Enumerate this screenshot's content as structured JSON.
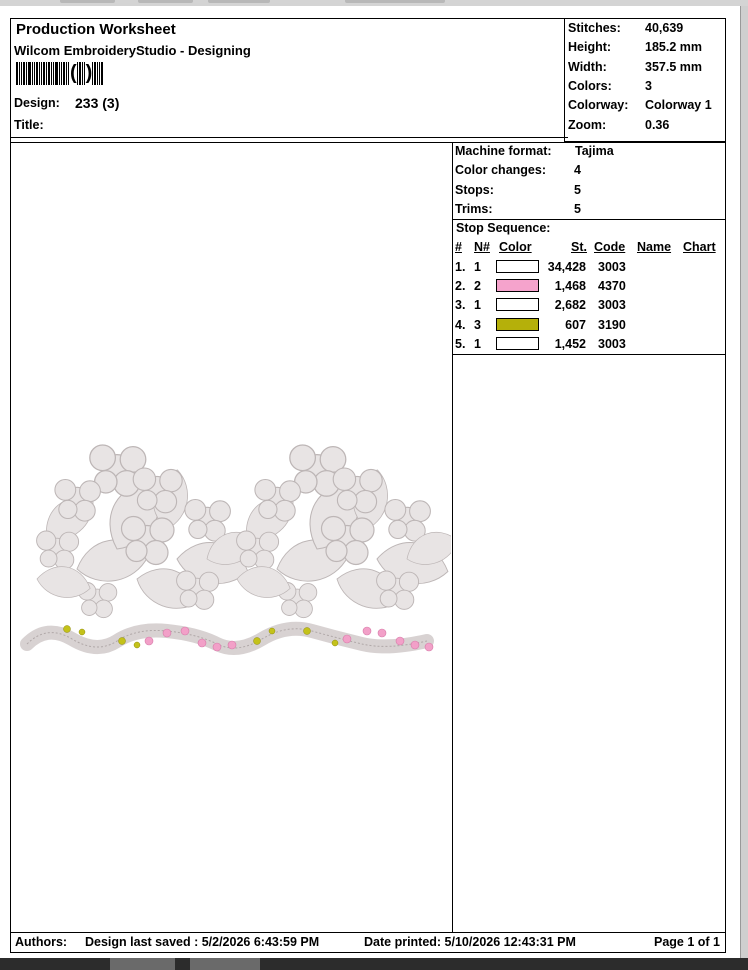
{
  "header": {
    "title": "Production Worksheet",
    "subtitle": "Wilcom EmbroideryStudio - Designing",
    "design_label": "Design:",
    "design_value": "233 (3)",
    "title_label": "Title:",
    "title_value": ""
  },
  "stats": [
    {
      "label": "Stitches:",
      "value": "40,639"
    },
    {
      "label": "Height:",
      "value": "185.2 mm"
    },
    {
      "label": "Width:",
      "value": "357.5 mm"
    },
    {
      "label": "Colors:",
      "value": "3"
    },
    {
      "label": "Colorway:",
      "value": "Colorway 1"
    },
    {
      "label": "Zoom:",
      "value": "0.36"
    }
  ],
  "machine": [
    {
      "label": "Machine format:",
      "value": "Tajima"
    },
    {
      "label": "Color changes:",
      "value": "4"
    },
    {
      "label": "Stops:",
      "value": "5"
    },
    {
      "label": "Trims:",
      "value": "5"
    }
  ],
  "stop_sequence": {
    "title": "Stop Sequence:",
    "columns": [
      "#",
      "N#",
      "Color",
      "St.",
      "Code",
      "Name",
      "Chart"
    ],
    "rows": [
      {
        "num": "1.",
        "n": "1",
        "color": "#ffffff",
        "st": "34,428",
        "code": "3003"
      },
      {
        "num": "2.",
        "n": "2",
        "color": "#f5a3cc",
        "st": "1,468",
        "code": "4370"
      },
      {
        "num": "3.",
        "n": "1",
        "color": "#ffffff",
        "st": "2,682",
        "code": "3003"
      },
      {
        "num": "4.",
        "n": "3",
        "color": "#b5b00a",
        "st": "607",
        "code": "3190"
      },
      {
        "num": "5.",
        "n": "1",
        "color": "#ffffff",
        "st": "1,452",
        "code": "3003"
      }
    ]
  },
  "footer": {
    "authors_label": "Authors:",
    "saved": "Design last saved : 5/2/2026 6:43:59 PM",
    "printed": "Date printed: 5/10/2026 12:43:31 PM",
    "page": "Page 1 of 1"
  },
  "colors": {
    "lace": "#e8e4e4",
    "lace_stroke": "#bdb6b6",
    "pink": "#f2a0c8",
    "olive": "#c4c21a"
  }
}
